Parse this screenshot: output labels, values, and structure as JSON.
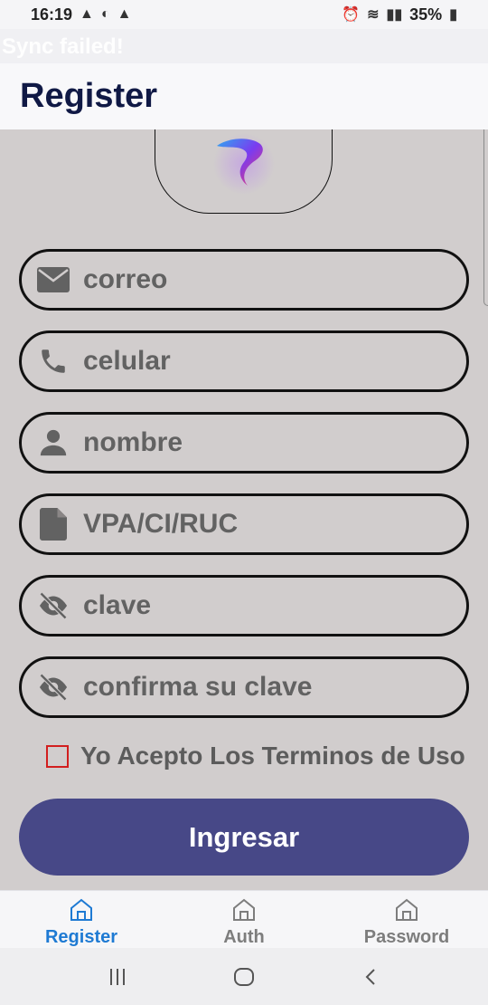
{
  "status_bar": {
    "time": "16:19",
    "battery": "35%"
  },
  "sync_banner": {
    "text": "Sync failed!"
  },
  "header": {
    "title": "Register"
  },
  "form": {
    "fields": [
      {
        "placeholder": "correo",
        "icon": "envelope-icon"
      },
      {
        "placeholder": "celular",
        "icon": "phone-icon"
      },
      {
        "placeholder": "nombre",
        "icon": "person-icon"
      },
      {
        "placeholder": "VPA/CI/RUC",
        "icon": "document-icon"
      },
      {
        "placeholder": "clave",
        "icon": "eye-off-icon"
      },
      {
        "placeholder": "confirma su clave",
        "icon": "eye-off-icon"
      }
    ],
    "terms_label": "Yo Acepto Los Terminos de Uso",
    "submit_label": "Ingresar"
  },
  "tabs": [
    {
      "label": "Register",
      "icon": "home-icon",
      "active": true
    },
    {
      "label": "Auth",
      "icon": "home-icon",
      "active": false
    },
    {
      "label": "Password",
      "icon": "home-icon",
      "active": false
    }
  ],
  "colors": {
    "accent": "#474887",
    "active_tab": "#1e7ad3",
    "form_background": "#d1cdcd",
    "checkbox_border": "#d21e1e",
    "title": "#101945"
  }
}
